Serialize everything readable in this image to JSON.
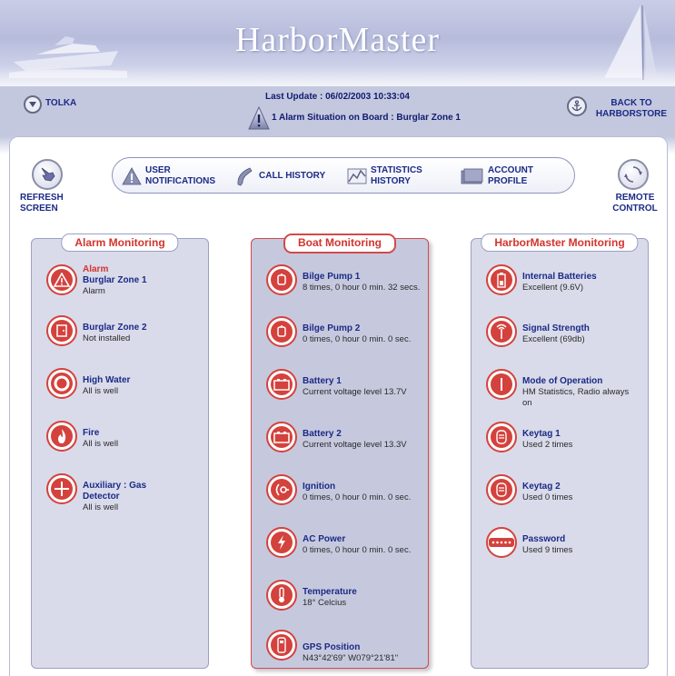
{
  "header": {
    "title": "HarborMaster",
    "last_update": "Last Update : 06/02/2003 10:33:04",
    "alarm_notice": "1 Alarm Situation on Board : Burglar Zone 1",
    "boat_name": "TOLKA",
    "back_line1": "BACK TO",
    "back_line2": "HARBORSTORE"
  },
  "toolbar": {
    "refresh_line1": "REFRESH",
    "refresh_line2": "SCREEN",
    "remote_line1": "REMOTE",
    "remote_line2": "CONTROL",
    "tabs": [
      {
        "line1": "USER",
        "line2": "NOTIFICATIONS",
        "icon": "warning-icon"
      },
      {
        "line1": "CALL HISTORY",
        "line2": "",
        "icon": "phone-icon"
      },
      {
        "line1": "STATISTICS",
        "line2": "HISTORY",
        "icon": "chart-icon"
      },
      {
        "line1": "ACCOUNT",
        "line2": "PROFILE",
        "icon": "folder-icon"
      }
    ]
  },
  "alarm_panel": {
    "title": "Alarm Monitoring",
    "items": [
      {
        "flag": "Alarm",
        "name": "Burglar Zone 1",
        "status": "Alarm",
        "icon": "warning-icon"
      },
      {
        "flag": "",
        "name": "Burglar Zone 2",
        "status": "Not installed",
        "icon": "door-icon"
      },
      {
        "flag": "",
        "name": "High Water",
        "status": "All is well",
        "icon": "lifebuoy-icon"
      },
      {
        "flag": "",
        "name": "Fire",
        "status": "All is well",
        "icon": "fire-icon"
      },
      {
        "flag": "",
        "name": "Auxiliary : Gas Detector",
        "status": "All is well",
        "icon": "cross-icon"
      }
    ]
  },
  "boat_panel": {
    "title": "Boat Monitoring",
    "items": [
      {
        "name": "Bilge Pump 1",
        "status": "8 times, 0 hour 0 min. 32 secs.",
        "icon": "pump-icon"
      },
      {
        "name": "Bilge Pump 2",
        "status": "0 times, 0 hour 0 min. 0 sec.",
        "icon": "pump-icon"
      },
      {
        "name": "Battery 1",
        "status": "Current voltage level 13.7V",
        "icon": "battery-icon"
      },
      {
        "name": "Battery 2",
        "status": "Current voltage level 13.3V",
        "icon": "battery-icon"
      },
      {
        "name": "Ignition",
        "status": "0 times, 0 hour 0 min. 0 sec.",
        "icon": "ignition-icon"
      },
      {
        "name": "AC Power",
        "status": "0 times, 0 hour 0 min. 0 sec.",
        "icon": "lightning-icon"
      },
      {
        "name": "Temperature",
        "status": "18° Celcius",
        "icon": "thermometer-icon"
      },
      {
        "name": "GPS Position",
        "status": "N43°42'69\" W079°21'81\"",
        "icon": "gps-icon"
      }
    ]
  },
  "hm_panel": {
    "title": "HarborMaster Monitoring",
    "items": [
      {
        "name": "Internal Batteries",
        "status": "Excellent (9.6V)",
        "icon": "internal-battery-icon"
      },
      {
        "name": "Signal Strength",
        "status": "Excellent (69db)",
        "icon": "antenna-icon"
      },
      {
        "name": "Mode of Operation",
        "status": "HM Statistics, Radio always on",
        "icon": "mode-icon"
      },
      {
        "name": "Keytag 1",
        "status": "Used 2 times",
        "icon": "keytag-icon"
      },
      {
        "name": "Keytag 2",
        "status": "Used 0 times",
        "icon": "keytag-icon"
      },
      {
        "name": "Password",
        "status": "Used 9 times",
        "icon": "password-icon"
      }
    ]
  },
  "colors": {
    "accent_red": "#d2342e",
    "label_blue": "#1b2a86",
    "panel_bg": "#d9dbea",
    "header_bg": "#c4c8df"
  }
}
